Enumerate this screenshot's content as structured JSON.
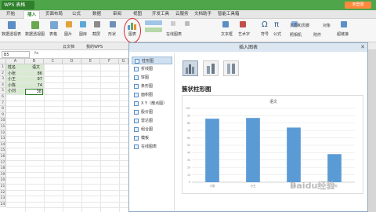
{
  "app": {
    "tab_label": "WPS 表格",
    "login_label": "未登录"
  },
  "menu": {
    "items": [
      "开始",
      "插入",
      "页面布局",
      "公式",
      "数据",
      "审阅",
      "视图",
      "开发工具",
      "云服务",
      "文档助手",
      "智能工具箱"
    ],
    "active_index": 1
  },
  "ribbon": {
    "labels": [
      "数据透视表",
      "数据透视图",
      "表格",
      "图片",
      "图库",
      "截屏",
      "形状",
      "图表",
      "在线图表",
      "文本框",
      "艺术字",
      "符号",
      "公式",
      "页眉和页脚",
      "对象",
      "照相机",
      "附件",
      "超链接"
    ]
  },
  "quickaccess": {
    "doc1": "云文档",
    "doc2": "我的WPS"
  },
  "formula_bar": {
    "name_box": "B5",
    "fx": "fx"
  },
  "sheet": {
    "columns": [
      "A",
      "B",
      "C",
      "D",
      "E",
      "F",
      "G"
    ],
    "header": {
      "name": "姓名",
      "score": "语文"
    },
    "rows": [
      {
        "name": "小张",
        "score": "86"
      },
      {
        "name": "小王",
        "score": "87"
      },
      {
        "name": "小陈",
        "score": "74"
      },
      {
        "name": "小刘",
        "score": "38"
      }
    ]
  },
  "dialog": {
    "title": "插入图表",
    "close": "✕",
    "chart_types": [
      "柱形图",
      "折线图",
      "饼图",
      "条形图",
      "面积图",
      "X Y（散点图）",
      "股价图",
      "雷达图",
      "组合图",
      "模板",
      "在线图表"
    ],
    "selected_type": "簇状柱形图"
  },
  "chart_data": {
    "type": "bar",
    "title": "语文",
    "categories": [
      "小张",
      "小王",
      "小陈",
      "小刘"
    ],
    "values": [
      86,
      87,
      74,
      38
    ],
    "ylim": [
      0,
      100
    ],
    "yticks": [
      0,
      10,
      20,
      30,
      40,
      50,
      60,
      70,
      80,
      90,
      100
    ],
    "bar_color": "#5b9bd5"
  },
  "watermark": "Baidu经验"
}
